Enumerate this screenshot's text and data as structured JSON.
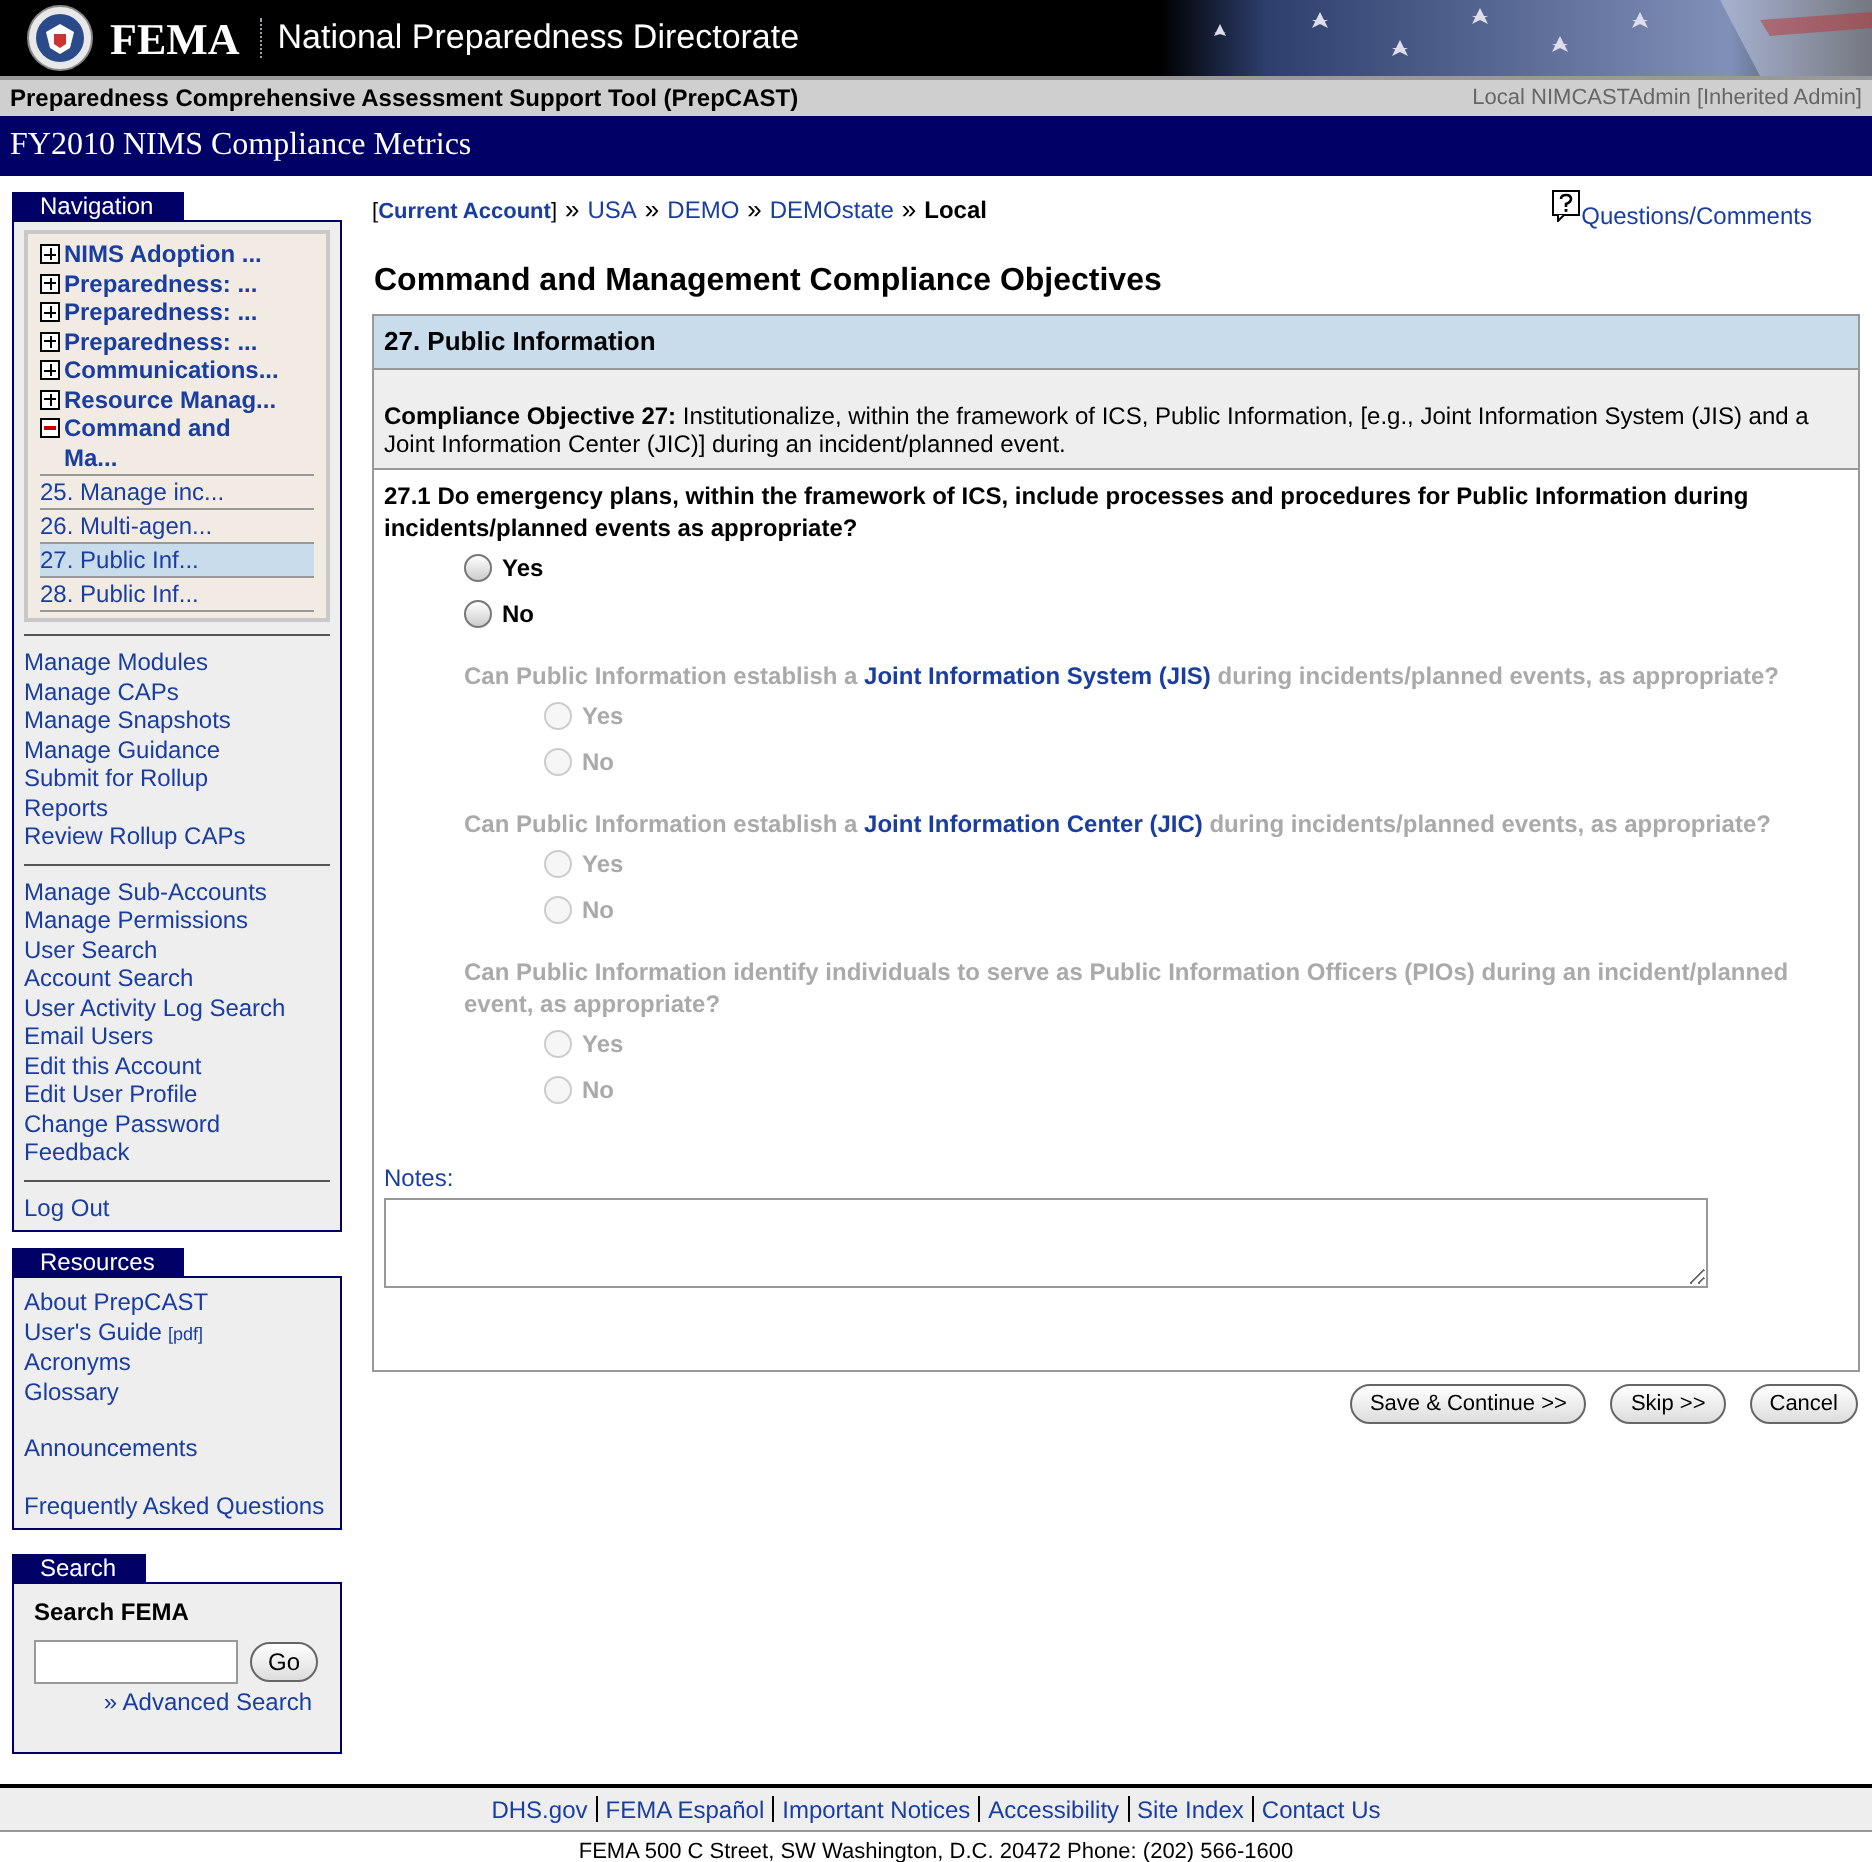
{
  "header": {
    "brand": "FEMA",
    "directorate": "National Preparedness Directorate"
  },
  "tool_bar": {
    "title": "Preparedness Comprehensive Assessment Support Tool (PrepCAST)",
    "user": "Local NIMCASTAdmin [Inherited Admin]"
  },
  "title_bar": {
    "title": "FY2010 NIMS Compliance Metrics"
  },
  "navigation": {
    "title": "Navigation",
    "tree": [
      {
        "label": "NIMS Adoption ...",
        "expanded": false
      },
      {
        "label": "Preparedness: ...",
        "expanded": false
      },
      {
        "label": "Preparedness: ...",
        "expanded": false
      },
      {
        "label": "Preparedness: ...",
        "expanded": false
      },
      {
        "label": "Communications...",
        "expanded": false
      },
      {
        "label": "Resource Manag...",
        "expanded": false
      },
      {
        "label": "Command and Ma...",
        "expanded": true,
        "children": [
          {
            "label": "25. Manage inc...",
            "selected": false
          },
          {
            "label": "26. Multi-agen...",
            "selected": false
          },
          {
            "label": "27. Public Inf...",
            "selected": true
          },
          {
            "label": "28. Public Inf...",
            "selected": false
          }
        ]
      }
    ],
    "link_groups": [
      [
        "Manage Modules",
        "Manage CAPs",
        "Manage Snapshots",
        "Manage Guidance",
        "Submit for Rollup",
        "Reports",
        "Review Rollup CAPs"
      ],
      [
        "Manage Sub-Accounts",
        "Manage Permissions",
        "User Search",
        "Account Search",
        "User Activity Log Search",
        "Email Users",
        "Edit this Account",
        "Edit User Profile",
        "Change Password",
        "Feedback"
      ],
      [
        "Log Out"
      ]
    ]
  },
  "resources": {
    "title": "Resources",
    "groups": [
      [
        {
          "label": "About PrepCAST"
        },
        {
          "label": "User's Guide",
          "note": "[pdf]"
        },
        {
          "label": "Acronyms"
        },
        {
          "label": "Glossary"
        }
      ],
      [
        {
          "label": "Announcements"
        }
      ],
      [
        {
          "label": "Frequently Asked Questions"
        }
      ]
    ]
  },
  "search": {
    "title": "Search",
    "heading": "Search FEMA",
    "button": "Go",
    "advanced_link": "» Advanced Search"
  },
  "breadcrumb": {
    "open": "[",
    "account": "Current Account",
    "close": "]",
    "items": [
      {
        "label": "USA"
      },
      {
        "label": "DEMO"
      },
      {
        "label": "DEMOstate"
      },
      {
        "label": "Local"
      }
    ],
    "separator": "»"
  },
  "help_link": "Questions/Comments",
  "page_title": "Command and Management Compliance Objectives",
  "section": {
    "title": "27. Public Information",
    "objective": "**Compliance Objective 27:** Institutionalize, within the framework of ICS, Public Information, [e.g., Joint Information System (JIS) and a Joint Information Center (JIC)] during an incident/planned event.",
    "question": {
      "text": "27.1 Do emergency plans, within the framework of ICS, include processes and procedures for Public Information during incidents/planned events as appropriate?",
      "options": [
        {
          "label": "Yes",
          "checked": false
        },
        {
          "label": "No",
          "checked": false
        }
      ]
    },
    "sub_questions": [
      {
        "before": "Can Public Information establish a",
        "link": "Joint Information System (JIS)",
        "after": "during incidents/planned events, as appropriate?",
        "disabled": true,
        "options": [
          {
            "label": "Yes",
            "checked": false
          },
          {
            "label": "No",
            "checked": false
          }
        ]
      },
      {
        "before": "Can Public Information establish a",
        "link": "Joint Information Center (JIC)",
        "after": "during incidents/planned events, as appropriate?",
        "disabled": true,
        "options": [
          {
            "label": "Yes",
            "checked": false
          },
          {
            "label": "No",
            "checked": false
          }
        ]
      },
      {
        "before": "Can Public Information identify individuals to serve as Public Information Officers (PIOs) during an incident/planned event, as appropriate?",
        "disabled": true,
        "options": [
          {
            "label": "Yes",
            "checked": false
          },
          {
            "label": "No",
            "checked": false
          }
        ]
      }
    ],
    "notes_label": "Notes:"
  },
  "buttons": [
    "Save & Continue >>",
    "Skip >>",
    "Cancel"
  ],
  "footer": {
    "links": [
      "DHS.gov",
      "FEMA Español",
      "Important Notices",
      "Accessibility",
      "Site Index",
      "Contact Us"
    ],
    "address": "FEMA 500 C Street, SW Washington, D.C. 20472 Phone: (202) 566-1600"
  }
}
